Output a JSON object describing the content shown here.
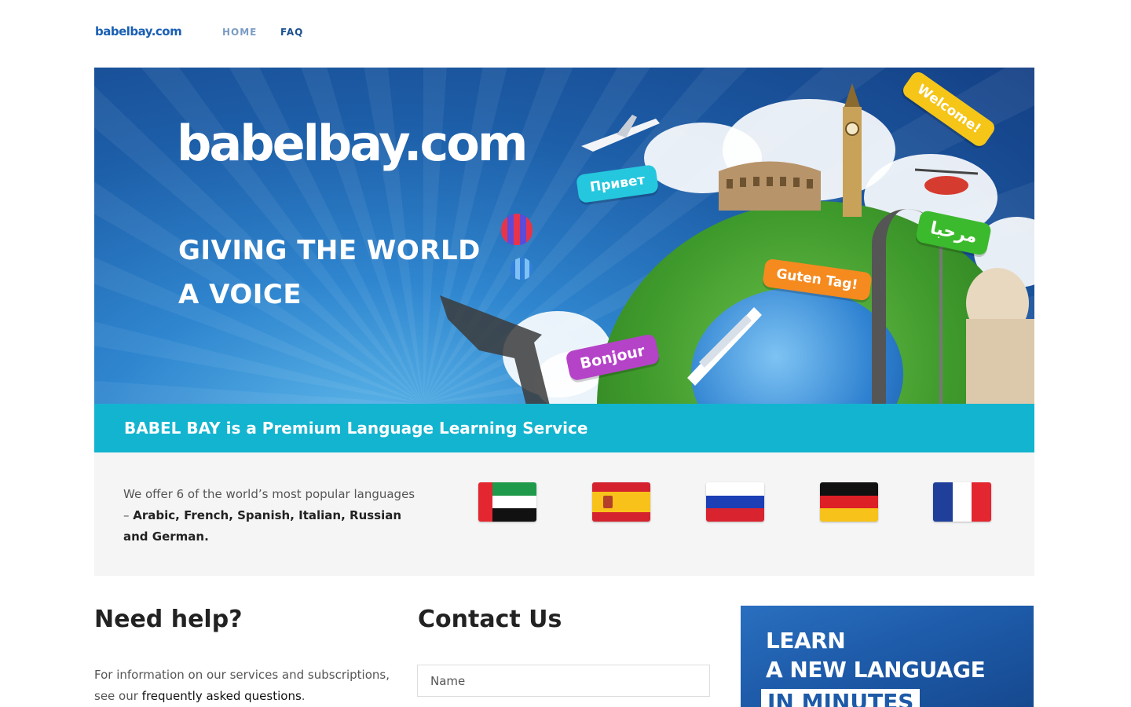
{
  "nav": {
    "logo": "babelbay.com",
    "home": "HOME",
    "faq": "FAQ"
  },
  "hero": {
    "brand": "babelbay.com",
    "tagline_line1": "GIVING THE WORLD",
    "tagline_line2": "A VOICE",
    "greetings": {
      "russian": "Привет",
      "welcome": "Welcome!",
      "arabic": "مرحبا",
      "german": "Guten Tag!",
      "french": "Bonjour"
    }
  },
  "strip": {
    "text": "BABEL BAY is a Premium Language Learning Service"
  },
  "languages": {
    "intro": "We offer 6 of the world’s most popular languages –",
    "list": "Arabic, French, Spanish, Italian, Russian and German.",
    "flags": [
      "uae-flag",
      "spain-flag",
      "russia-flag",
      "germany-flag",
      "france-flag"
    ]
  },
  "help": {
    "heading": "Need help?",
    "text_before": "For information on our services and subscriptions, see our ",
    "link": "frequently asked questions",
    "text_after": "."
  },
  "contact": {
    "heading": "Contact Us",
    "name_placeholder": "Name"
  },
  "ad": {
    "line1": "LEARN",
    "line2": "A NEW LANGUAGE",
    "line3": "IN MINUTES"
  },
  "colors": {
    "accent_strip": "#13b4cf",
    "logo_blue": "#1a5fb4",
    "panel_bg": "#f5f5f5"
  }
}
